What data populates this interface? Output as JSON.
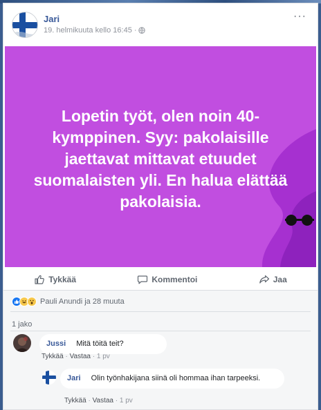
{
  "post": {
    "author": "Jari",
    "timestamp": "19. helmikuuta kello 16:45",
    "privacy_icon": "globe-icon",
    "more_icon": "···",
    "text": "Lopetin työt, olen noin 40-kymppinen. Syy: pakolaisille jaettavat mittavat etuudet suomalaisten yli. En halua elättää pakolaisia.",
    "background_color": "#c14ee0"
  },
  "actions": {
    "like": "Tykkää",
    "comment": "Kommentoi",
    "share": "Jaa"
  },
  "reactions": {
    "icons": [
      "like-icon",
      "haha-icon",
      "wow-icon"
    ],
    "text": "Pauli Anundi ja 28 muuta"
  },
  "shares": "1 jako",
  "comments": [
    {
      "author": "Jussi",
      "text": "Mitä töitä teit?",
      "like": "Tykkää",
      "reply": "Vastaa",
      "time": "1 pv"
    },
    {
      "author": "Jari",
      "text": "Olin työnhakijana siinä oli hommaa ihan tarpeeksi.",
      "like": "Tykkää",
      "reply": "Vastaa",
      "time": "1 pv"
    }
  ]
}
